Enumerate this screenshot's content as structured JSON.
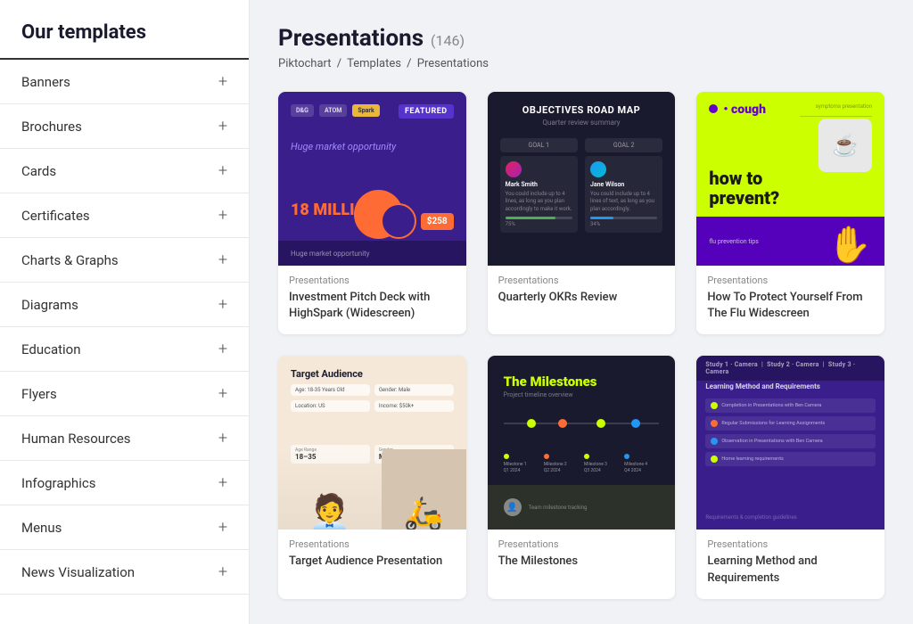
{
  "sidebar": {
    "title": "Our templates",
    "items": [
      {
        "label": "Banners",
        "id": "banners"
      },
      {
        "label": "Brochures",
        "id": "brochures"
      },
      {
        "label": "Cards",
        "id": "cards"
      },
      {
        "label": "Certificates",
        "id": "certificates"
      },
      {
        "label": "Charts & Graphs",
        "id": "charts-graphs"
      },
      {
        "label": "Diagrams",
        "id": "diagrams"
      },
      {
        "label": "Education",
        "id": "education"
      },
      {
        "label": "Flyers",
        "id": "flyers"
      },
      {
        "label": "Human Resources",
        "id": "human-resources"
      },
      {
        "label": "Infographics",
        "id": "infographics"
      },
      {
        "label": "Menus",
        "id": "menus"
      },
      {
        "label": "News Visualization",
        "id": "news-visualization"
      }
    ]
  },
  "main": {
    "page_title": "Presentations",
    "template_count": "(146)",
    "breadcrumb": {
      "root": "Piktochart",
      "sep1": "/",
      "mid": "Templates",
      "sep2": "/",
      "current": "Presentations"
    },
    "templates": [
      {
        "id": "1",
        "category": "Presentations",
        "name": "Investment Pitch Deck with HighSpark (Widescreen)"
      },
      {
        "id": "2",
        "category": "Presentations",
        "name": "Quarterly OKRs Review"
      },
      {
        "id": "3",
        "category": "Presentations",
        "name": "How To Protect Yourself From The Flu Widescreen"
      },
      {
        "id": "4",
        "category": "Presentations",
        "name": "Target Audience Presentation"
      },
      {
        "id": "5",
        "category": "Presentations",
        "name": "The Milestones"
      },
      {
        "id": "6",
        "category": "Presentations",
        "name": "Learning Method and Requirements"
      }
    ]
  }
}
